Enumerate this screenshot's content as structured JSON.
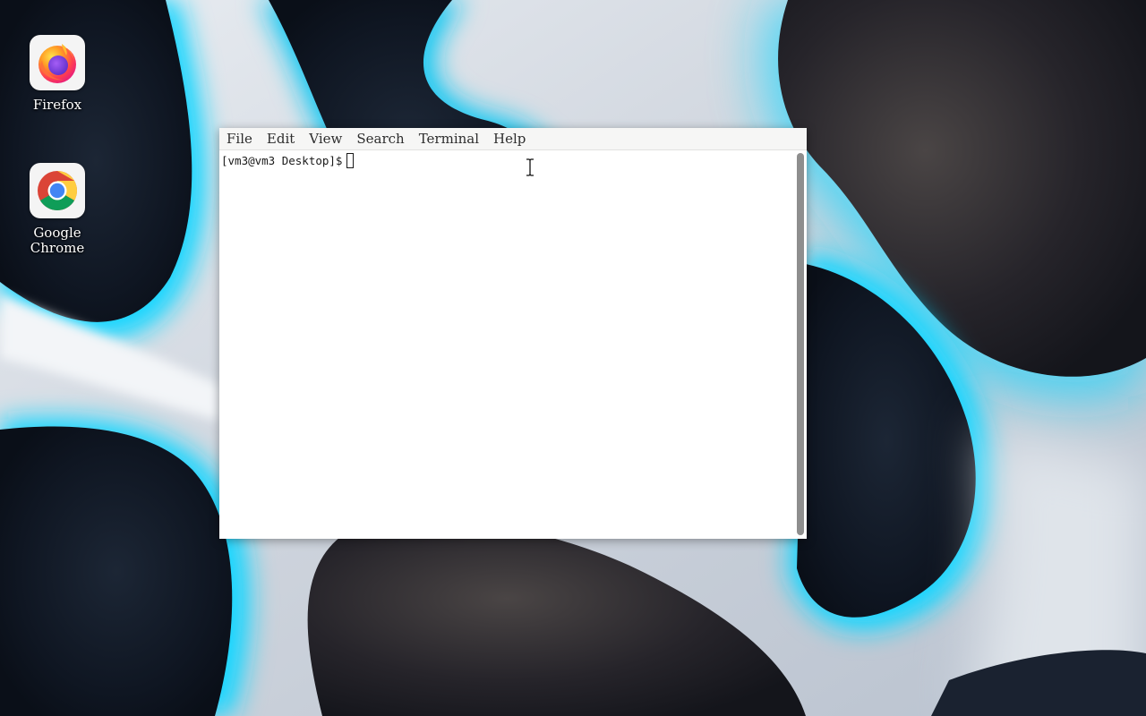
{
  "desktop": {
    "icons": [
      {
        "label": "Firefox",
        "icon": "firefox-icon"
      },
      {
        "label": "Google\nChrome",
        "icon": "chrome-icon"
      }
    ]
  },
  "terminal": {
    "menu": [
      "File",
      "Edit",
      "View",
      "Search",
      "Terminal",
      "Help"
    ],
    "prompt": "[vm3@vm3 Desktop]$"
  },
  "colors": {
    "wallpaper_dark": "#0d1420",
    "wallpaper_accent": "#19d6ff",
    "wallpaper_light": "#eef1f5",
    "menubar_bg": "#f6f6f5",
    "scrollbar_thumb": "#8e8e8e"
  },
  "pointer": {
    "icon": "ibeam-cursor-icon"
  }
}
